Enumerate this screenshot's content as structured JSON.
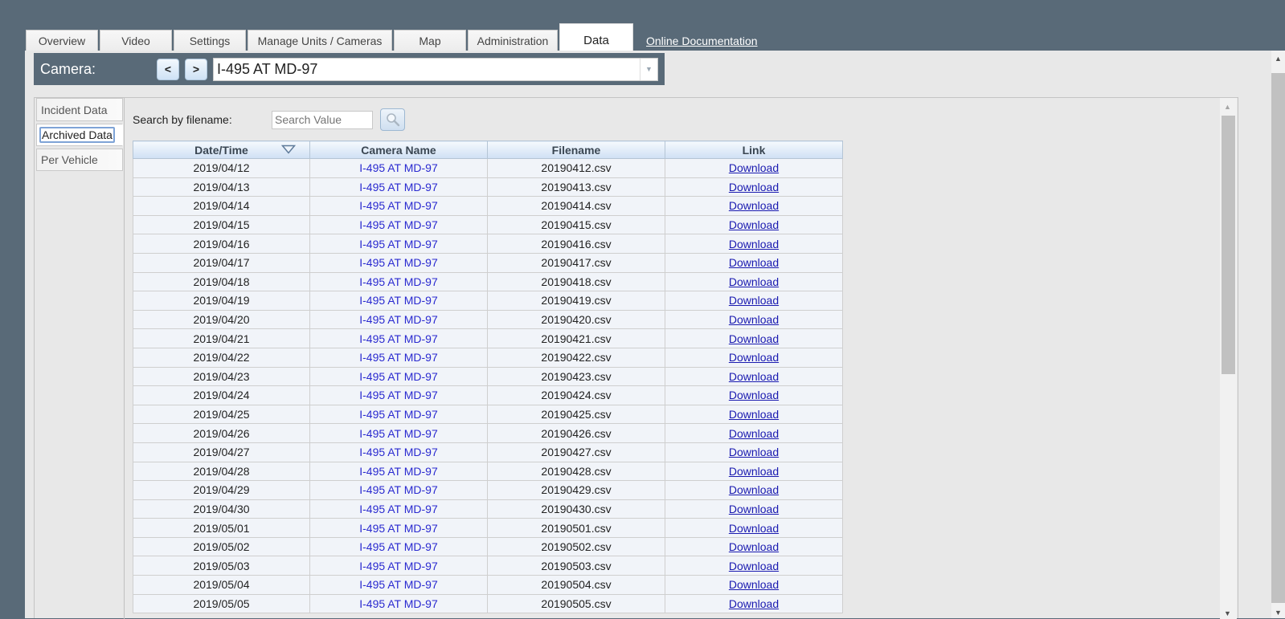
{
  "top_tabs": [
    {
      "label": "Overview",
      "active": false
    },
    {
      "label": "Video",
      "active": false
    },
    {
      "label": "Settings",
      "active": false
    },
    {
      "label": "Manage Units / Cameras",
      "active": false
    },
    {
      "label": "Map",
      "active": false
    },
    {
      "label": "Administration",
      "active": false
    },
    {
      "label": "Data",
      "active": true
    }
  ],
  "doc_link": "Online Documentation",
  "camera_bar": {
    "label": "Camera:",
    "prev_label": "<",
    "next_label": ">",
    "selected_camera": "I-495 AT MD-97"
  },
  "side_tabs": [
    {
      "label": "Incident Data",
      "active": false
    },
    {
      "label": "Archived Data",
      "active": true
    },
    {
      "label": "Per Vehicle",
      "active": false
    }
  ],
  "search": {
    "label": "Search by filename:",
    "placeholder": "Search Value",
    "value": ""
  },
  "table": {
    "columns": [
      "Date/Time",
      "Camera Name",
      "Filename",
      "Link"
    ],
    "sort_column": "Date/Time",
    "rows": [
      {
        "date": "2019/04/12",
        "camera": "I-495 AT MD-97",
        "filename": "20190412.csv",
        "link": "Download"
      },
      {
        "date": "2019/04/13",
        "camera": "I-495 AT MD-97",
        "filename": "20190413.csv",
        "link": "Download"
      },
      {
        "date": "2019/04/14",
        "camera": "I-495 AT MD-97",
        "filename": "20190414.csv",
        "link": "Download"
      },
      {
        "date": "2019/04/15",
        "camera": "I-495 AT MD-97",
        "filename": "20190415.csv",
        "link": "Download"
      },
      {
        "date": "2019/04/16",
        "camera": "I-495 AT MD-97",
        "filename": "20190416.csv",
        "link": "Download"
      },
      {
        "date": "2019/04/17",
        "camera": "I-495 AT MD-97",
        "filename": "20190417.csv",
        "link": "Download"
      },
      {
        "date": "2019/04/18",
        "camera": "I-495 AT MD-97",
        "filename": "20190418.csv",
        "link": "Download"
      },
      {
        "date": "2019/04/19",
        "camera": "I-495 AT MD-97",
        "filename": "20190419.csv",
        "link": "Download"
      },
      {
        "date": "2019/04/20",
        "camera": "I-495 AT MD-97",
        "filename": "20190420.csv",
        "link": "Download"
      },
      {
        "date": "2019/04/21",
        "camera": "I-495 AT MD-97",
        "filename": "20190421.csv",
        "link": "Download"
      },
      {
        "date": "2019/04/22",
        "camera": "I-495 AT MD-97",
        "filename": "20190422.csv",
        "link": "Download"
      },
      {
        "date": "2019/04/23",
        "camera": "I-495 AT MD-97",
        "filename": "20190423.csv",
        "link": "Download"
      },
      {
        "date": "2019/04/24",
        "camera": "I-495 AT MD-97",
        "filename": "20190424.csv",
        "link": "Download"
      },
      {
        "date": "2019/04/25",
        "camera": "I-495 AT MD-97",
        "filename": "20190425.csv",
        "link": "Download"
      },
      {
        "date": "2019/04/26",
        "camera": "I-495 AT MD-97",
        "filename": "20190426.csv",
        "link": "Download"
      },
      {
        "date": "2019/04/27",
        "camera": "I-495 AT MD-97",
        "filename": "20190427.csv",
        "link": "Download"
      },
      {
        "date": "2019/04/28",
        "camera": "I-495 AT MD-97",
        "filename": "20190428.csv",
        "link": "Download"
      },
      {
        "date": "2019/04/29",
        "camera": "I-495 AT MD-97",
        "filename": "20190429.csv",
        "link": "Download"
      },
      {
        "date": "2019/04/30",
        "camera": "I-495 AT MD-97",
        "filename": "20190430.csv",
        "link": "Download"
      },
      {
        "date": "2019/05/01",
        "camera": "I-495 AT MD-97",
        "filename": "20190501.csv",
        "link": "Download"
      },
      {
        "date": "2019/05/02",
        "camera": "I-495 AT MD-97",
        "filename": "20190502.csv",
        "link": "Download"
      },
      {
        "date": "2019/05/03",
        "camera": "I-495 AT MD-97",
        "filename": "20190503.csv",
        "link": "Download"
      },
      {
        "date": "2019/05/04",
        "camera": "I-495 AT MD-97",
        "filename": "20190504.csv",
        "link": "Download"
      },
      {
        "date": "2019/05/05",
        "camera": "I-495 AT MD-97",
        "filename": "20190505.csv",
        "link": "Download"
      }
    ]
  },
  "icons": {
    "sort": "triangle-down-icon",
    "search": "magnifier-icon",
    "dropdown": "chevron-down-icon",
    "scroll_up": "arrow-up-icon",
    "scroll_down": "arrow-down-icon"
  },
  "colors": {
    "background": "#596a78",
    "panel": "#e8e8e8",
    "camera_text": "#2a2ad0",
    "link": "#1a1ab0",
    "header_gradient_end": "#cfe0f4"
  }
}
